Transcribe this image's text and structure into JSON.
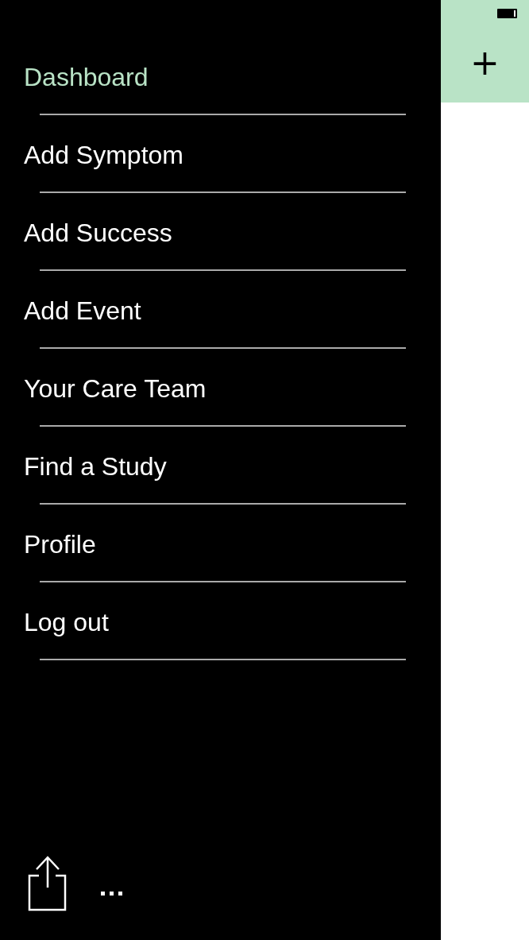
{
  "menu": [
    {
      "label": "Dashboard",
      "selected": true
    },
    {
      "label": "Add Symptom",
      "selected": false
    },
    {
      "label": "Add Success",
      "selected": false
    },
    {
      "label": "Add Event",
      "selected": false
    },
    {
      "label": "Your Care Team",
      "selected": false
    },
    {
      "label": "Find a Study",
      "selected": false
    },
    {
      "label": "Profile",
      "selected": false
    },
    {
      "label": "Log out",
      "selected": false
    }
  ],
  "toolbar": {
    "add_button": "+"
  }
}
